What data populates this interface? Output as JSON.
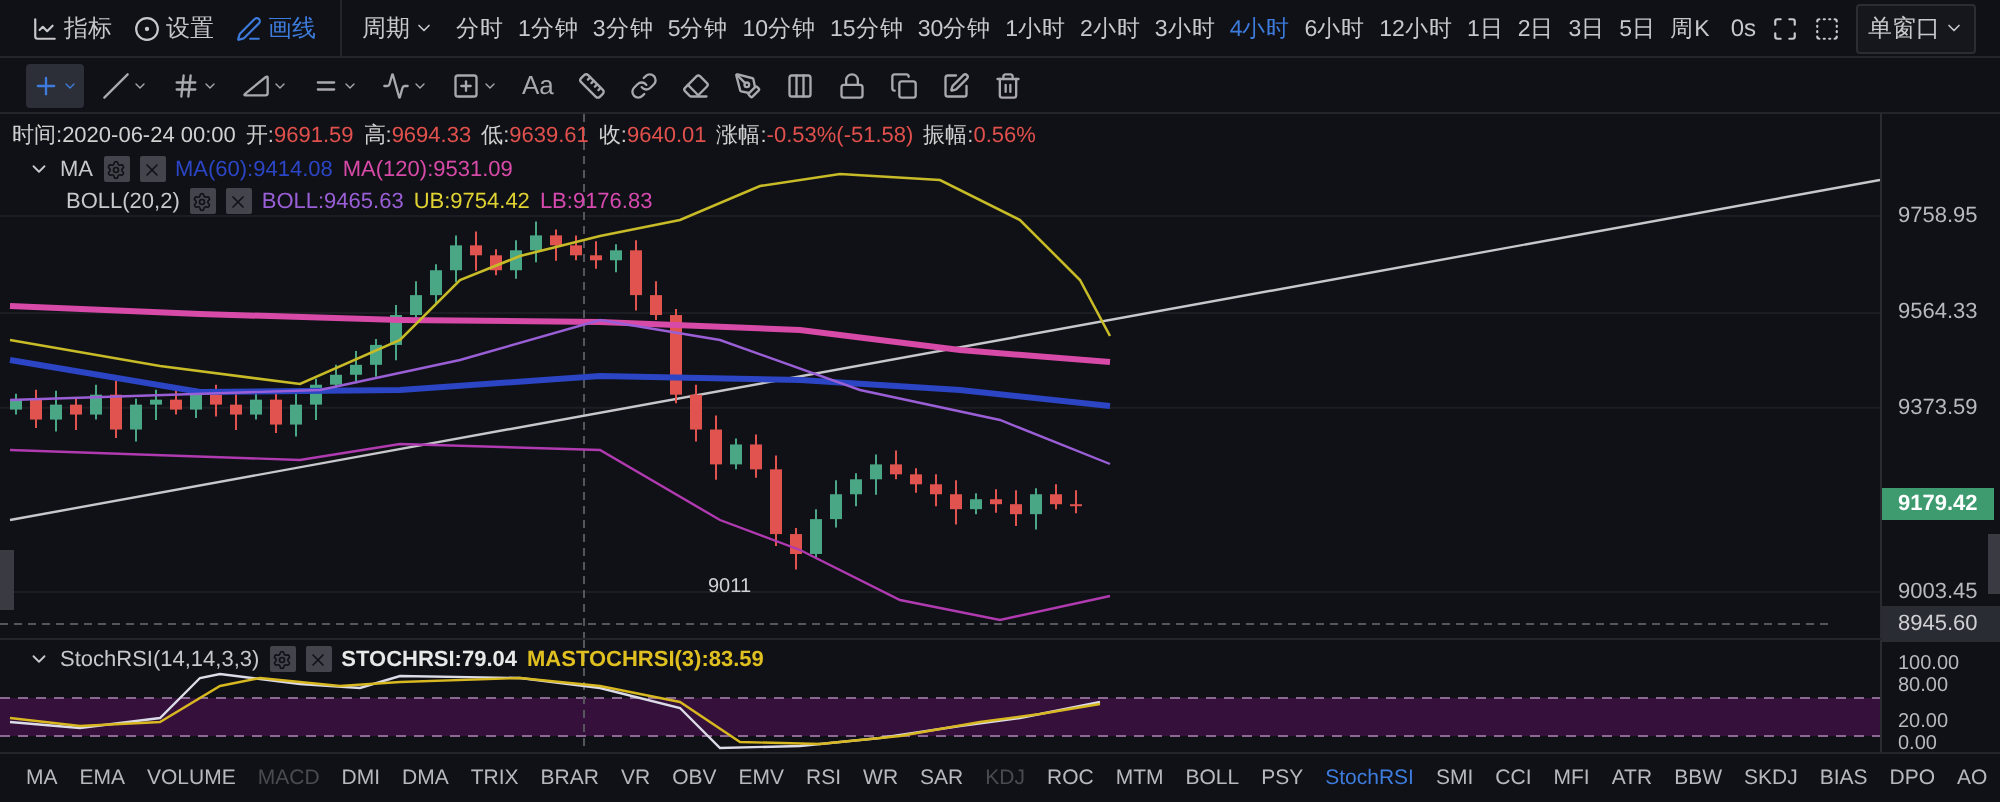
{
  "top_bar": {
    "menu": [
      {
        "kind": "indicator",
        "label": "指标",
        "selected": false
      },
      {
        "kind": "settings",
        "label": "设置",
        "selected": false
      },
      {
        "kind": "draw",
        "label": "画线",
        "selected": true
      }
    ],
    "period_label": "周期",
    "periods": [
      {
        "label": "分时",
        "selected": false
      },
      {
        "label": "1分钟",
        "selected": false
      },
      {
        "label": "3分钟",
        "selected": false
      },
      {
        "label": "5分钟",
        "selected": false
      },
      {
        "label": "10分钟",
        "selected": false
      },
      {
        "label": "15分钟",
        "selected": false
      },
      {
        "label": "30分钟",
        "selected": false
      },
      {
        "label": "1小时",
        "selected": false
      },
      {
        "label": "2小时",
        "selected": false
      },
      {
        "label": "3小时",
        "selected": false
      },
      {
        "label": "4小时",
        "selected": true
      },
      {
        "label": "6小时",
        "selected": false
      },
      {
        "label": "12小时",
        "selected": false
      },
      {
        "label": "1日",
        "selected": false
      },
      {
        "label": "2日",
        "selected": false
      },
      {
        "label": "3日",
        "selected": false
      },
      {
        "label": "5日",
        "selected": false
      },
      {
        "label": "周K",
        "selected": false
      }
    ],
    "countdown": "0s",
    "window_mode": "单窗口"
  },
  "toolbar": [
    {
      "kind": "crosshair",
      "selected": true,
      "dropdown": true
    },
    {
      "kind": "trend-line",
      "selected": false,
      "dropdown": true
    },
    {
      "kind": "parallel",
      "selected": false,
      "dropdown": true
    },
    {
      "kind": "angle",
      "selected": false,
      "dropdown": true
    },
    {
      "kind": "levels",
      "selected": false,
      "dropdown": true
    },
    {
      "kind": "wave",
      "selected": false,
      "dropdown": true
    },
    {
      "kind": "box",
      "selected": false,
      "dropdown": true
    },
    {
      "kind": "text",
      "label": "Aa",
      "selected": false,
      "dropdown": false
    },
    {
      "kind": "ruler",
      "selected": false,
      "dropdown": false
    },
    {
      "kind": "link",
      "selected": false,
      "dropdown": false
    },
    {
      "kind": "eraser",
      "selected": false,
      "dropdown": false
    },
    {
      "kind": "brush",
      "selected": false,
      "dropdown": false
    },
    {
      "kind": "bars",
      "selected": false,
      "dropdown": false
    },
    {
      "kind": "lock",
      "selected": false,
      "dropdown": false
    },
    {
      "kind": "copy",
      "selected": false,
      "dropdown": false
    },
    {
      "kind": "edit",
      "selected": false,
      "dropdown": false
    },
    {
      "kind": "delete",
      "selected": false,
      "dropdown": false
    }
  ],
  "ohlc": [
    {
      "label": "时间:",
      "value": "2020-06-24 00:00",
      "color": "#d0d0d0"
    },
    {
      "label": "开:",
      "value": "9691.59",
      "color": "#e0504c"
    },
    {
      "label": "高:",
      "value": "9694.33",
      "color": "#e0504c"
    },
    {
      "label": "低:",
      "value": "9639.61",
      "color": "#e0504c"
    },
    {
      "label": "收:",
      "value": "9640.01",
      "color": "#e0504c"
    },
    {
      "label": "涨幅:",
      "value": "-0.53%(-51.58)",
      "color": "#e0504c"
    },
    {
      "label": "振幅:",
      "value": "0.56%",
      "color": "#e0504c"
    }
  ],
  "indicators": [
    {
      "name": "MA",
      "toggle": true,
      "values": [
        {
          "text": "MA(60):9414.08",
          "color": "#2b45c5"
        },
        {
          "text": "MA(120):9531.09",
          "color": "#d84aa8"
        }
      ]
    },
    {
      "name": "BOLL(20,2)",
      "toggle": false,
      "values": [
        {
          "text": "BOLL:9465.63",
          "color": "#9a5fd6"
        },
        {
          "text": "UB:9754.42",
          "color": "#e0d232"
        },
        {
          "text": "LB:9176.83",
          "color": "#d64ab0"
        }
      ]
    }
  ],
  "chart": {
    "low_label": "9011"
  },
  "price_axis": {
    "ticks": [
      "9758.95",
      "9564.33",
      "9373.59",
      "9003.45"
    ],
    "current_price": "9179.42",
    "cursor_price": "8945.60"
  },
  "stoch_panel": {
    "name": "StochRSI(14,14,3,3)",
    "toggle": true,
    "values": [
      {
        "text": "STOCHRSI:79.04",
        "color": "#e8e8e8"
      },
      {
        "text": "MASTOCHRSI(3):83.59",
        "color": "#e0c020"
      }
    ],
    "axis": [
      "100.00",
      "80.00",
      "20.00",
      "0.00"
    ]
  },
  "indicator_tabs": [
    {
      "label": "MA",
      "selected": false,
      "disabled": false
    },
    {
      "label": "EMA",
      "selected": false,
      "disabled": false
    },
    {
      "label": "VOLUME",
      "selected": false,
      "disabled": false
    },
    {
      "label": "MACD",
      "selected": false,
      "disabled": true
    },
    {
      "label": "DMI",
      "selected": false,
      "disabled": false
    },
    {
      "label": "DMA",
      "selected": false,
      "disabled": false
    },
    {
      "label": "TRIX",
      "selected": false,
      "disabled": false
    },
    {
      "label": "BRAR",
      "selected": false,
      "disabled": false
    },
    {
      "label": "VR",
      "selected": false,
      "disabled": false
    },
    {
      "label": "OBV",
      "selected": false,
      "disabled": false
    },
    {
      "label": "EMV",
      "selected": false,
      "disabled": false
    },
    {
      "label": "RSI",
      "selected": false,
      "disabled": false
    },
    {
      "label": "WR",
      "selected": false,
      "disabled": false
    },
    {
      "label": "SAR",
      "selected": false,
      "disabled": false
    },
    {
      "label": "KDJ",
      "selected": false,
      "disabled": true
    },
    {
      "label": "ROC",
      "selected": false,
      "disabled": false
    },
    {
      "label": "MTM",
      "selected": false,
      "disabled": false
    },
    {
      "label": "BOLL",
      "selected": false,
      "disabled": false
    },
    {
      "label": "PSY",
      "selected": false,
      "disabled": false
    },
    {
      "label": "StochRSI",
      "selected": true,
      "disabled": false
    },
    {
      "label": "SMI",
      "selected": false,
      "disabled": false
    },
    {
      "label": "CCI",
      "selected": false,
      "disabled": false
    },
    {
      "label": "MFI",
      "selected": false,
      "disabled": false
    },
    {
      "label": "ATR",
      "selected": false,
      "disabled": false
    },
    {
      "label": "BBW",
      "selected": false,
      "disabled": false
    },
    {
      "label": "SKDJ",
      "selected": false,
      "disabled": false
    },
    {
      "label": "BIAS",
      "selected": false,
      "disabled": false
    },
    {
      "label": "DPO",
      "selected": false,
      "disabled": false
    },
    {
      "label": "AO",
      "selected": false,
      "disabled": false
    }
  ]
}
